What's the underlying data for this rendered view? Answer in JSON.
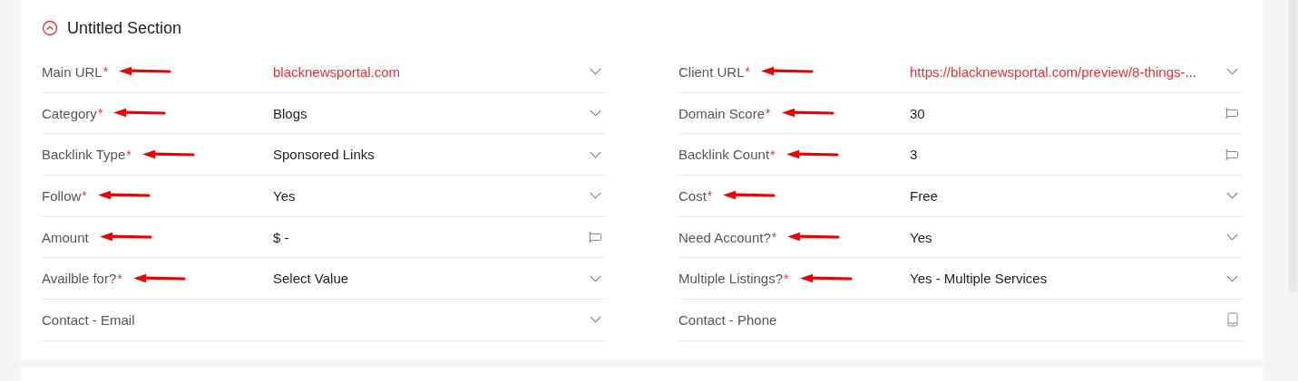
{
  "section": {
    "title": "Untitled Section",
    "expanded": true
  },
  "columns": [
    {
      "fields": [
        {
          "label": "Main URL",
          "required_mark": "*",
          "annotated": true,
          "kind": "dropdown",
          "value": "blacknewsportal.com",
          "link": true
        },
        {
          "label": "Category",
          "required_mark": "*",
          "annotated": true,
          "kind": "dropdown",
          "value": "Blogs",
          "link": false
        },
        {
          "label": "Backlink Type",
          "required_mark": "*",
          "annotated": true,
          "kind": "dropdown",
          "value": "Sponsored Links",
          "link": false
        },
        {
          "label": "Follow",
          "required_mark": "*",
          "annotated": true,
          "kind": "dropdown",
          "value": "Yes",
          "link": false
        },
        {
          "label": "Amount",
          "annotated": true,
          "kind": "number",
          "value": "$ -",
          "link": false
        },
        {
          "label": "Availble for?",
          "required_mark": "*",
          "annotated": true,
          "kind": "dropdown",
          "value": "Select Value",
          "link": false
        },
        {
          "label": "Contact - Email",
          "annotated": false,
          "kind": "dropdown"
        }
      ]
    },
    {
      "fields": [
        {
          "label": "Client URL",
          "required_mark": "*",
          "annotated": true,
          "kind": "dropdown",
          "value": "https://blacknewsportal.com/preview/8-things-",
          "ellipsis": "...",
          "link": true
        },
        {
          "label": "Domain Score",
          "required_mark": "*",
          "annotated": true,
          "kind": "number",
          "value": "30",
          "link": false
        },
        {
          "label": "Backlink Count",
          "required_mark": "*",
          "annotated": true,
          "kind": "number",
          "value": "3",
          "link": false
        },
        {
          "label": "Cost",
          "required_mark": "*",
          "annotated": true,
          "kind": "dropdown",
          "value": "Free",
          "link": false
        },
        {
          "label": "Need Account?",
          "required_mark": "*",
          "annotated": true,
          "kind": "dropdown",
          "value": "Yes",
          "link": false
        },
        {
          "label": "Multiple Listings?",
          "required_mark": "*",
          "annotated": true,
          "kind": "dropdown",
          "value": "Yes - Multiple Services",
          "link": false
        },
        {
          "label": "Contact - Phone",
          "annotated": false,
          "kind": "phone"
        }
      ]
    }
  ]
}
